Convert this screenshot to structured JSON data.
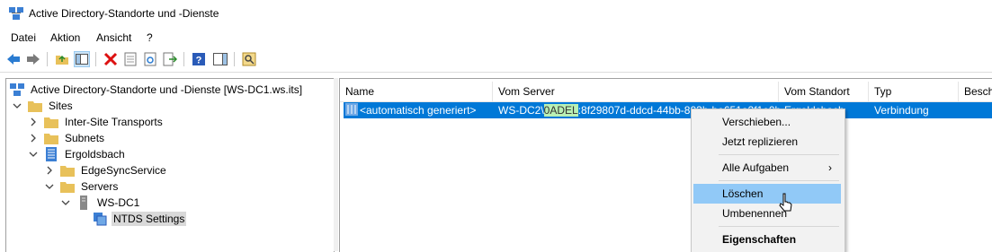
{
  "window": {
    "title": "Active Directory-Standorte und -Dienste"
  },
  "menu": [
    "Datei",
    "Aktion",
    "Ansicht",
    "?"
  ],
  "tree": {
    "root": "Active Directory-Standorte und -Dienste [WS-DC1.ws.its]",
    "sites": "Sites",
    "inter_site": "Inter-Site Transports",
    "subnets": "Subnets",
    "site": "Ergoldsbach",
    "edgesync": "EdgeSyncService",
    "servers": "Servers",
    "server": "WS-DC1",
    "ntds": "NTDS Settings"
  },
  "list": {
    "columns": [
      "Name",
      "Vom Server",
      "Vom Standort",
      "Typ",
      "Besch"
    ],
    "row": {
      "name": "<automatisch generiert>",
      "server_prefix": "WS-DC2\\",
      "server_highlight": "0ADEL",
      "server_rest": ":8f29807d-ddcd-44bb-803b-be651a2f1e0b",
      "site": "Ergoldsbach",
      "type": "Verbindung"
    }
  },
  "context_menu": {
    "move": "Verschieben...",
    "replicate": "Jetzt replizieren",
    "all_tasks": "Alle Aufgaben",
    "delete": "Löschen",
    "rename": "Umbenennen",
    "properties": "Eigenschaften"
  },
  "colors": {
    "selection": "#0078d7",
    "menu_hover": "#91c9f7",
    "highlight": "#b9f0b4"
  }
}
